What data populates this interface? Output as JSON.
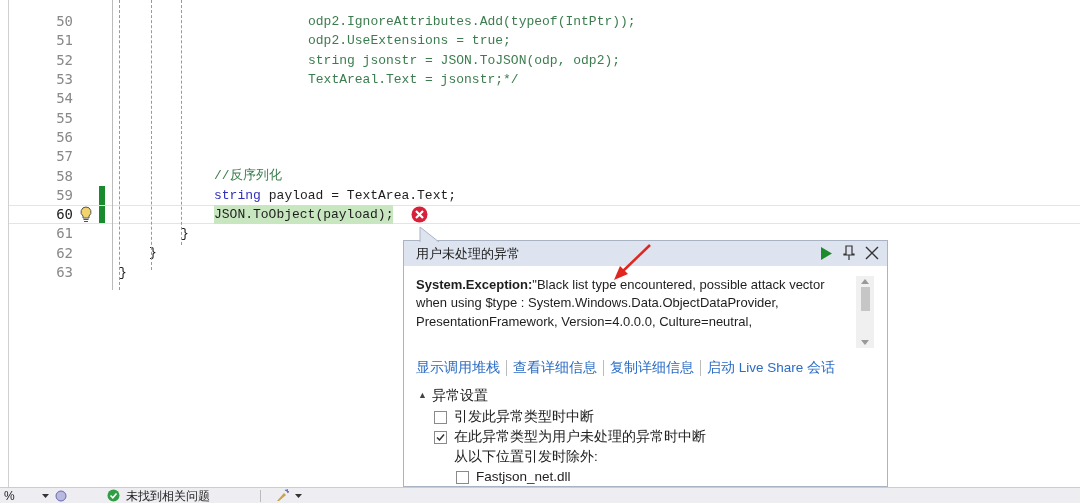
{
  "editor": {
    "lines": [
      {
        "number": "50",
        "kind": "commented",
        "tokens": [
          {
            "text": "odp2.IgnoreAttributes.Add(typeof(IntPtr));",
            "kind": "comment"
          }
        ]
      },
      {
        "number": "51",
        "kind": "commented",
        "tokens": [
          {
            "text": "odp2.UseExtensions = true;",
            "kind": "comment"
          }
        ]
      },
      {
        "number": "52",
        "kind": "commented",
        "tokens": [
          {
            "text": "string jsonstr = JSON.ToJSON(odp, odp2);",
            "kind": "comment"
          }
        ]
      },
      {
        "number": "53",
        "kind": "commented",
        "tokens": [
          {
            "text": "TextAreal.Text = jsonstr;*/",
            "kind": "comment"
          }
        ]
      },
      {
        "number": "54",
        "kind": "blank"
      },
      {
        "number": "55",
        "kind": "blank"
      },
      {
        "number": "56",
        "kind": "blank"
      },
      {
        "number": "57",
        "kind": "blank"
      },
      {
        "number": "58",
        "kind": "body",
        "changed": false,
        "tokens": [
          {
            "text": "//反序列化",
            "kind": "comment"
          }
        ]
      },
      {
        "number": "59",
        "kind": "body",
        "changed": true,
        "tokens": [
          {
            "text": "string",
            "kind": "keyword"
          },
          {
            "text": "payload = TextArea.Text;",
            "kind": "plain"
          }
        ]
      },
      {
        "number": "60",
        "kind": "body",
        "changed": true,
        "current": true,
        "error": true,
        "tokens": [
          {
            "text": "JSON.ToObject(payload);",
            "kind": "highlight"
          }
        ]
      },
      {
        "number": "61",
        "kind": "brace-inner",
        "tokens": [
          {
            "text": "}",
            "kind": "plain"
          }
        ]
      },
      {
        "number": "62",
        "kind": "brace-method",
        "tokens": [
          {
            "text": "}",
            "kind": "plain"
          }
        ]
      },
      {
        "number": "63",
        "kind": "brace-class",
        "tokens": [
          {
            "text": "}",
            "kind": "plain"
          }
        ]
      }
    ]
  },
  "exception_popup": {
    "title": "用户未处理的异常",
    "message": "**System.Exception:**\"Black list type encountered, possible attack vector when using $type : System.Windows.Data.ObjectDataProvider, PresentationFramework, Version=4.0.0.0, Culture=neutral,",
    "links": [
      "显示调用堆栈",
      "查看详细信息",
      "复制详细信息",
      "启动 Live Share 会话"
    ],
    "settings": {
      "toggle": "▲",
      "title": "异常设置",
      "expanded": true,
      "items": [
        {
          "kind": "checkbox",
          "label": "引发此异常类型时中断",
          "checked": false
        },
        {
          "kind": "checkbox",
          "label": "在此异常类型为用户未处理的异常时中断",
          "checked": true
        },
        {
          "kind": "text",
          "label": "从以下位置引发时除外:"
        },
        {
          "kind": "sub-checkbox",
          "label": "Fastjson_net.dll",
          "checked": false
        }
      ]
    }
  },
  "status_bar": {
    "zoom": "%",
    "issues": "未找到相关问题"
  }
}
